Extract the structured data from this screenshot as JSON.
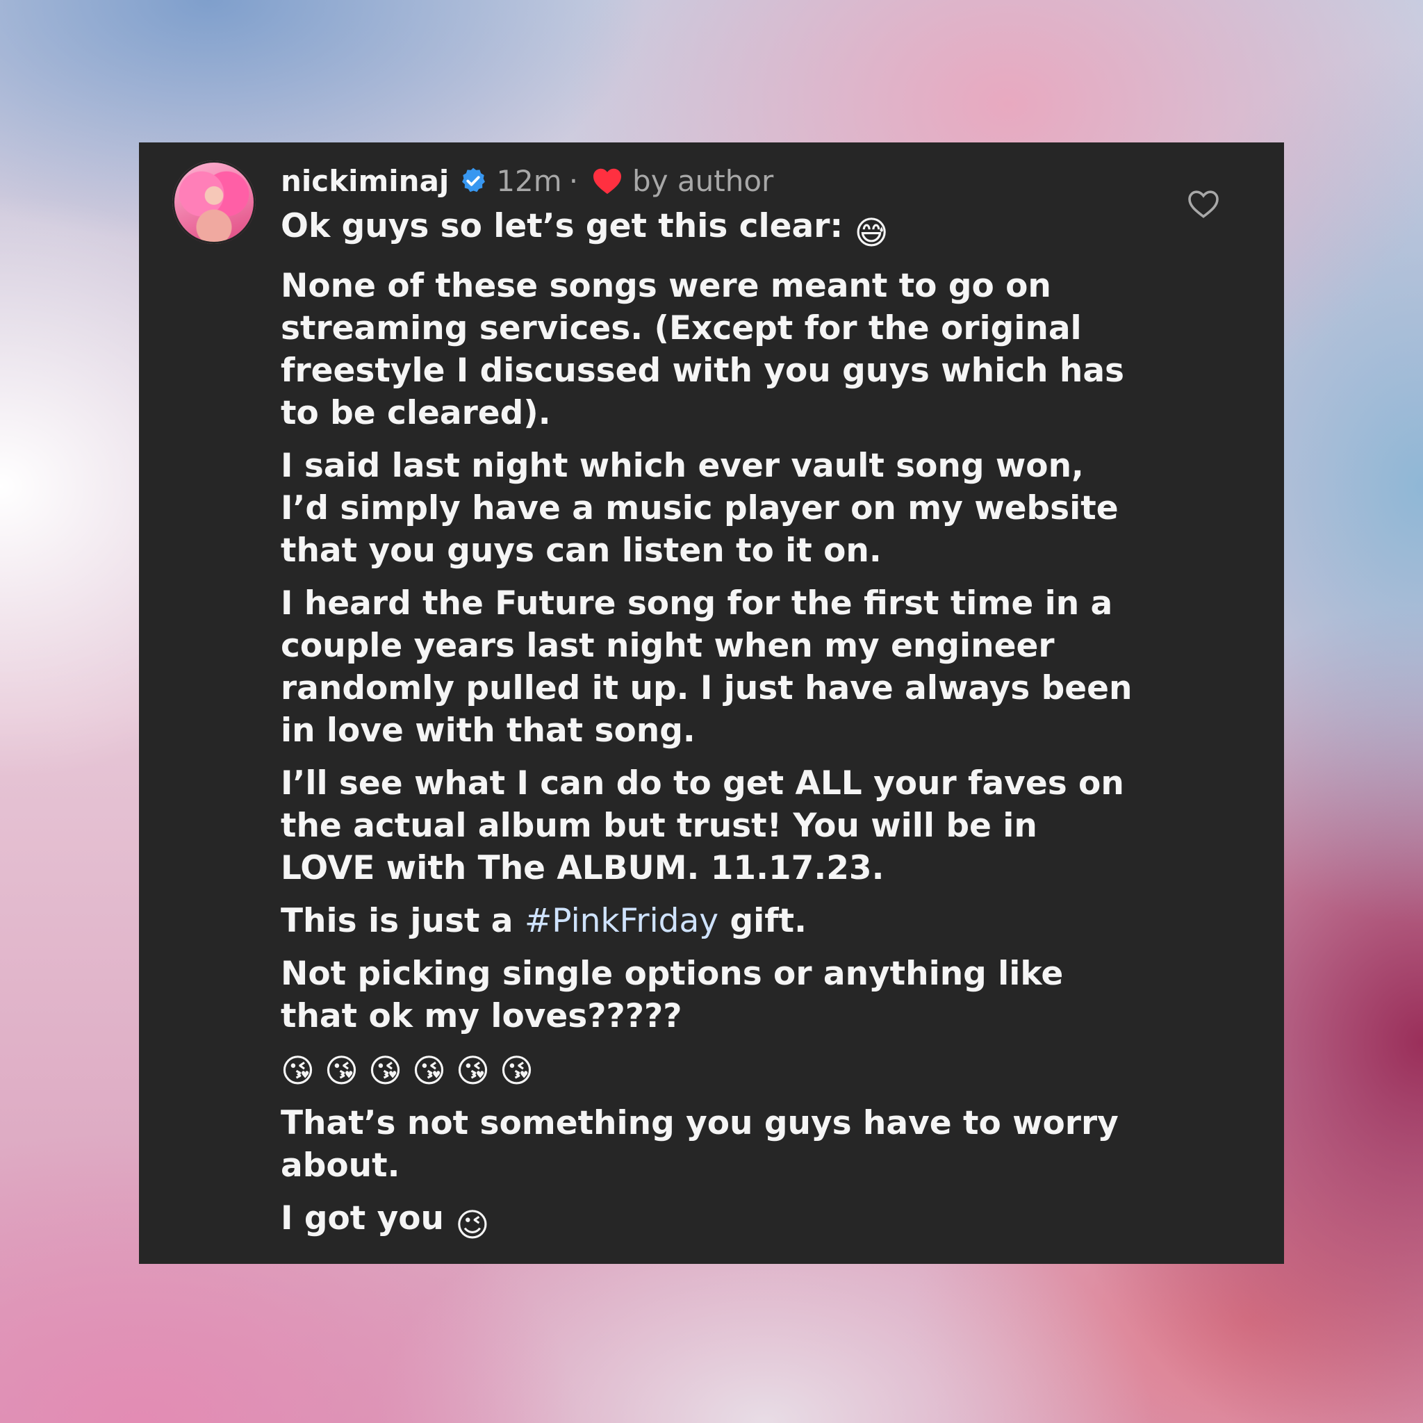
{
  "comment": {
    "username": "nickiminaj",
    "time": "12m",
    "separator": "·",
    "liked_label": "by author",
    "paragraphs": [
      "Ok guys so let’s get this clear:",
      "None of these songs were meant to go on streaming services. (Except for the original freestyle I discussed with you guys which has to be cleared).",
      "I said last night which ever vault song won, I’d simply have a music player on my website that you guys can listen to it on.",
      "I heard the Future song for the first time in a couple years last night when my engineer randomly pulled it up. I just have always been in love with that song.",
      "I’ll see what I can do to get ALL your faves on the actual album but trust! You will be in LOVE with The ALBUM. 11.17.23.",
      "Not picking single options or anything like that ok my loves?????",
      "That’s not something you guys have to worry about.",
      "I got you"
    ],
    "gift_line": {
      "before": "This is just a ",
      "hashtag": "#PinkFriday",
      "after": " gift."
    },
    "emojis": {
      "sweat_smile": "😅",
      "kiss_row": [
        "😘",
        "😘",
        "😘",
        "😘",
        "😘",
        "😘"
      ],
      "wink": "😉"
    }
  },
  "icons": {
    "verified": "verified-badge-icon",
    "liked_heart": "red-heart-icon",
    "like": "heart-outline-icon"
  },
  "colors": {
    "card_bg": "#262626",
    "text": "#f5f5f5",
    "muted": "#a8a8a8",
    "hashtag": "#cfe3ff",
    "verified_blue": "#3897f0",
    "heart_red": "#ff3040"
  }
}
